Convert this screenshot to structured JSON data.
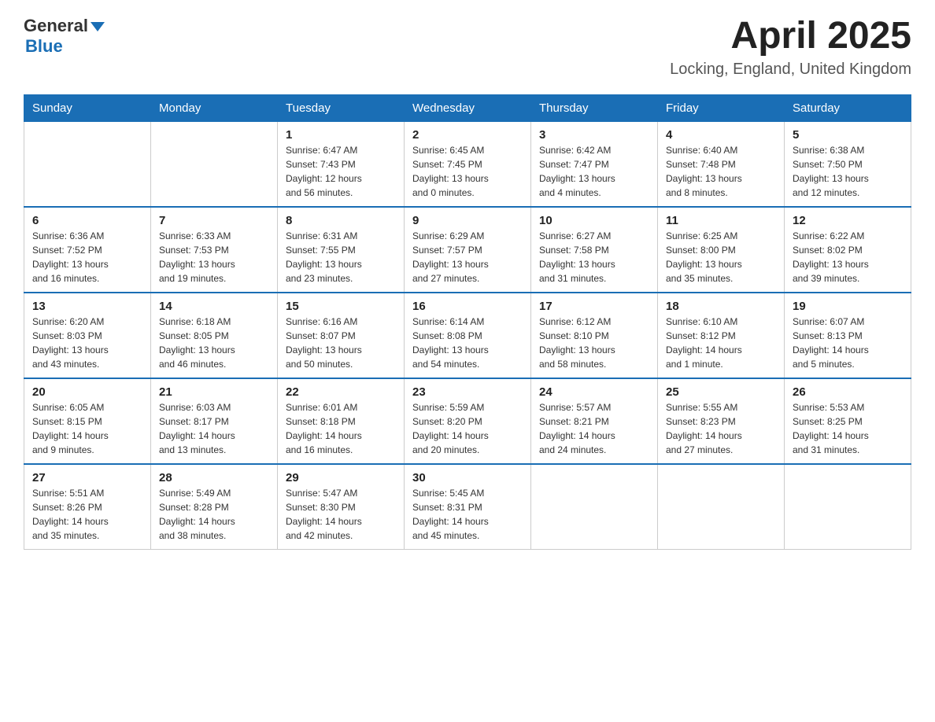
{
  "header": {
    "logo_general": "General",
    "logo_blue": "Blue",
    "month": "April 2025",
    "location": "Locking, England, United Kingdom"
  },
  "weekdays": [
    "Sunday",
    "Monday",
    "Tuesday",
    "Wednesday",
    "Thursday",
    "Friday",
    "Saturday"
  ],
  "weeks": [
    [
      {
        "day": "",
        "info": ""
      },
      {
        "day": "",
        "info": ""
      },
      {
        "day": "1",
        "info": "Sunrise: 6:47 AM\nSunset: 7:43 PM\nDaylight: 12 hours\nand 56 minutes."
      },
      {
        "day": "2",
        "info": "Sunrise: 6:45 AM\nSunset: 7:45 PM\nDaylight: 13 hours\nand 0 minutes."
      },
      {
        "day": "3",
        "info": "Sunrise: 6:42 AM\nSunset: 7:47 PM\nDaylight: 13 hours\nand 4 minutes."
      },
      {
        "day": "4",
        "info": "Sunrise: 6:40 AM\nSunset: 7:48 PM\nDaylight: 13 hours\nand 8 minutes."
      },
      {
        "day": "5",
        "info": "Sunrise: 6:38 AM\nSunset: 7:50 PM\nDaylight: 13 hours\nand 12 minutes."
      }
    ],
    [
      {
        "day": "6",
        "info": "Sunrise: 6:36 AM\nSunset: 7:52 PM\nDaylight: 13 hours\nand 16 minutes."
      },
      {
        "day": "7",
        "info": "Sunrise: 6:33 AM\nSunset: 7:53 PM\nDaylight: 13 hours\nand 19 minutes."
      },
      {
        "day": "8",
        "info": "Sunrise: 6:31 AM\nSunset: 7:55 PM\nDaylight: 13 hours\nand 23 minutes."
      },
      {
        "day": "9",
        "info": "Sunrise: 6:29 AM\nSunset: 7:57 PM\nDaylight: 13 hours\nand 27 minutes."
      },
      {
        "day": "10",
        "info": "Sunrise: 6:27 AM\nSunset: 7:58 PM\nDaylight: 13 hours\nand 31 minutes."
      },
      {
        "day": "11",
        "info": "Sunrise: 6:25 AM\nSunset: 8:00 PM\nDaylight: 13 hours\nand 35 minutes."
      },
      {
        "day": "12",
        "info": "Sunrise: 6:22 AM\nSunset: 8:02 PM\nDaylight: 13 hours\nand 39 minutes."
      }
    ],
    [
      {
        "day": "13",
        "info": "Sunrise: 6:20 AM\nSunset: 8:03 PM\nDaylight: 13 hours\nand 43 minutes."
      },
      {
        "day": "14",
        "info": "Sunrise: 6:18 AM\nSunset: 8:05 PM\nDaylight: 13 hours\nand 46 minutes."
      },
      {
        "day": "15",
        "info": "Sunrise: 6:16 AM\nSunset: 8:07 PM\nDaylight: 13 hours\nand 50 minutes."
      },
      {
        "day": "16",
        "info": "Sunrise: 6:14 AM\nSunset: 8:08 PM\nDaylight: 13 hours\nand 54 minutes."
      },
      {
        "day": "17",
        "info": "Sunrise: 6:12 AM\nSunset: 8:10 PM\nDaylight: 13 hours\nand 58 minutes."
      },
      {
        "day": "18",
        "info": "Sunrise: 6:10 AM\nSunset: 8:12 PM\nDaylight: 14 hours\nand 1 minute."
      },
      {
        "day": "19",
        "info": "Sunrise: 6:07 AM\nSunset: 8:13 PM\nDaylight: 14 hours\nand 5 minutes."
      }
    ],
    [
      {
        "day": "20",
        "info": "Sunrise: 6:05 AM\nSunset: 8:15 PM\nDaylight: 14 hours\nand 9 minutes."
      },
      {
        "day": "21",
        "info": "Sunrise: 6:03 AM\nSunset: 8:17 PM\nDaylight: 14 hours\nand 13 minutes."
      },
      {
        "day": "22",
        "info": "Sunrise: 6:01 AM\nSunset: 8:18 PM\nDaylight: 14 hours\nand 16 minutes."
      },
      {
        "day": "23",
        "info": "Sunrise: 5:59 AM\nSunset: 8:20 PM\nDaylight: 14 hours\nand 20 minutes."
      },
      {
        "day": "24",
        "info": "Sunrise: 5:57 AM\nSunset: 8:21 PM\nDaylight: 14 hours\nand 24 minutes."
      },
      {
        "day": "25",
        "info": "Sunrise: 5:55 AM\nSunset: 8:23 PM\nDaylight: 14 hours\nand 27 minutes."
      },
      {
        "day": "26",
        "info": "Sunrise: 5:53 AM\nSunset: 8:25 PM\nDaylight: 14 hours\nand 31 minutes."
      }
    ],
    [
      {
        "day": "27",
        "info": "Sunrise: 5:51 AM\nSunset: 8:26 PM\nDaylight: 14 hours\nand 35 minutes."
      },
      {
        "day": "28",
        "info": "Sunrise: 5:49 AM\nSunset: 8:28 PM\nDaylight: 14 hours\nand 38 minutes."
      },
      {
        "day": "29",
        "info": "Sunrise: 5:47 AM\nSunset: 8:30 PM\nDaylight: 14 hours\nand 42 minutes."
      },
      {
        "day": "30",
        "info": "Sunrise: 5:45 AM\nSunset: 8:31 PM\nDaylight: 14 hours\nand 45 minutes."
      },
      {
        "day": "",
        "info": ""
      },
      {
        "day": "",
        "info": ""
      },
      {
        "day": "",
        "info": ""
      }
    ]
  ]
}
